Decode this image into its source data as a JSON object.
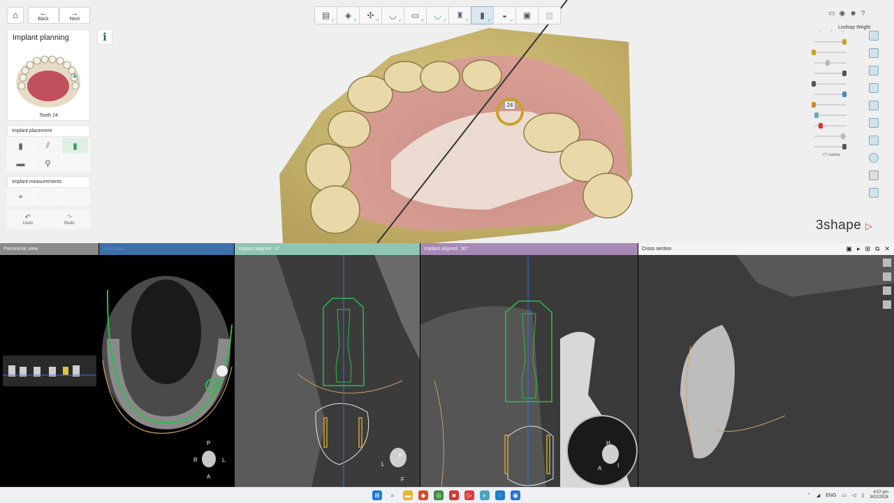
{
  "nav": {
    "back_label": "Back",
    "next_label": "Next"
  },
  "panel": {
    "title": "Implant planning",
    "info_label": "i",
    "tooth_label": "Tooth 24",
    "placement_label": "Implant placement",
    "measurements_label": "Implant measurements",
    "undo_label": "Undo",
    "redo_label": "Redo"
  },
  "model": {
    "tooth_marker": "24"
  },
  "user": {
    "name": "Lindsay Wright"
  },
  "right_panel": {
    "ct_label": "CT visibility",
    "scale_labels": [
      "1",
      "2",
      "3"
    ]
  },
  "brand": {
    "name": "3shape",
    "accent_color": "#e03a3a"
  },
  "views": {
    "panoramic": {
      "title": "Panoramic view",
      "color": "#8a8a8a"
    },
    "axial": {
      "title": "Axial view",
      "color": "#3d6fa8"
    },
    "implant0": {
      "title": "Implant aligned : 0°",
      "color": "#8fc5b3"
    },
    "implant90": {
      "title": "Implant aligned : 90°",
      "color": "#a789b6"
    },
    "cross": {
      "title": "Cross section",
      "color": "#f4f4f4"
    }
  },
  "orientation": {
    "axial": {
      "top": "P",
      "left": "R",
      "right": "L",
      "bottom": "A"
    },
    "implant0": {
      "top": "P",
      "left": "L",
      "bottom": "F"
    },
    "implant90": {
      "top": "H",
      "left": "A",
      "right": "I"
    }
  },
  "taskbar": {
    "lang": "ENG",
    "time": "4:57 pm",
    "date": "3/02/2026"
  }
}
